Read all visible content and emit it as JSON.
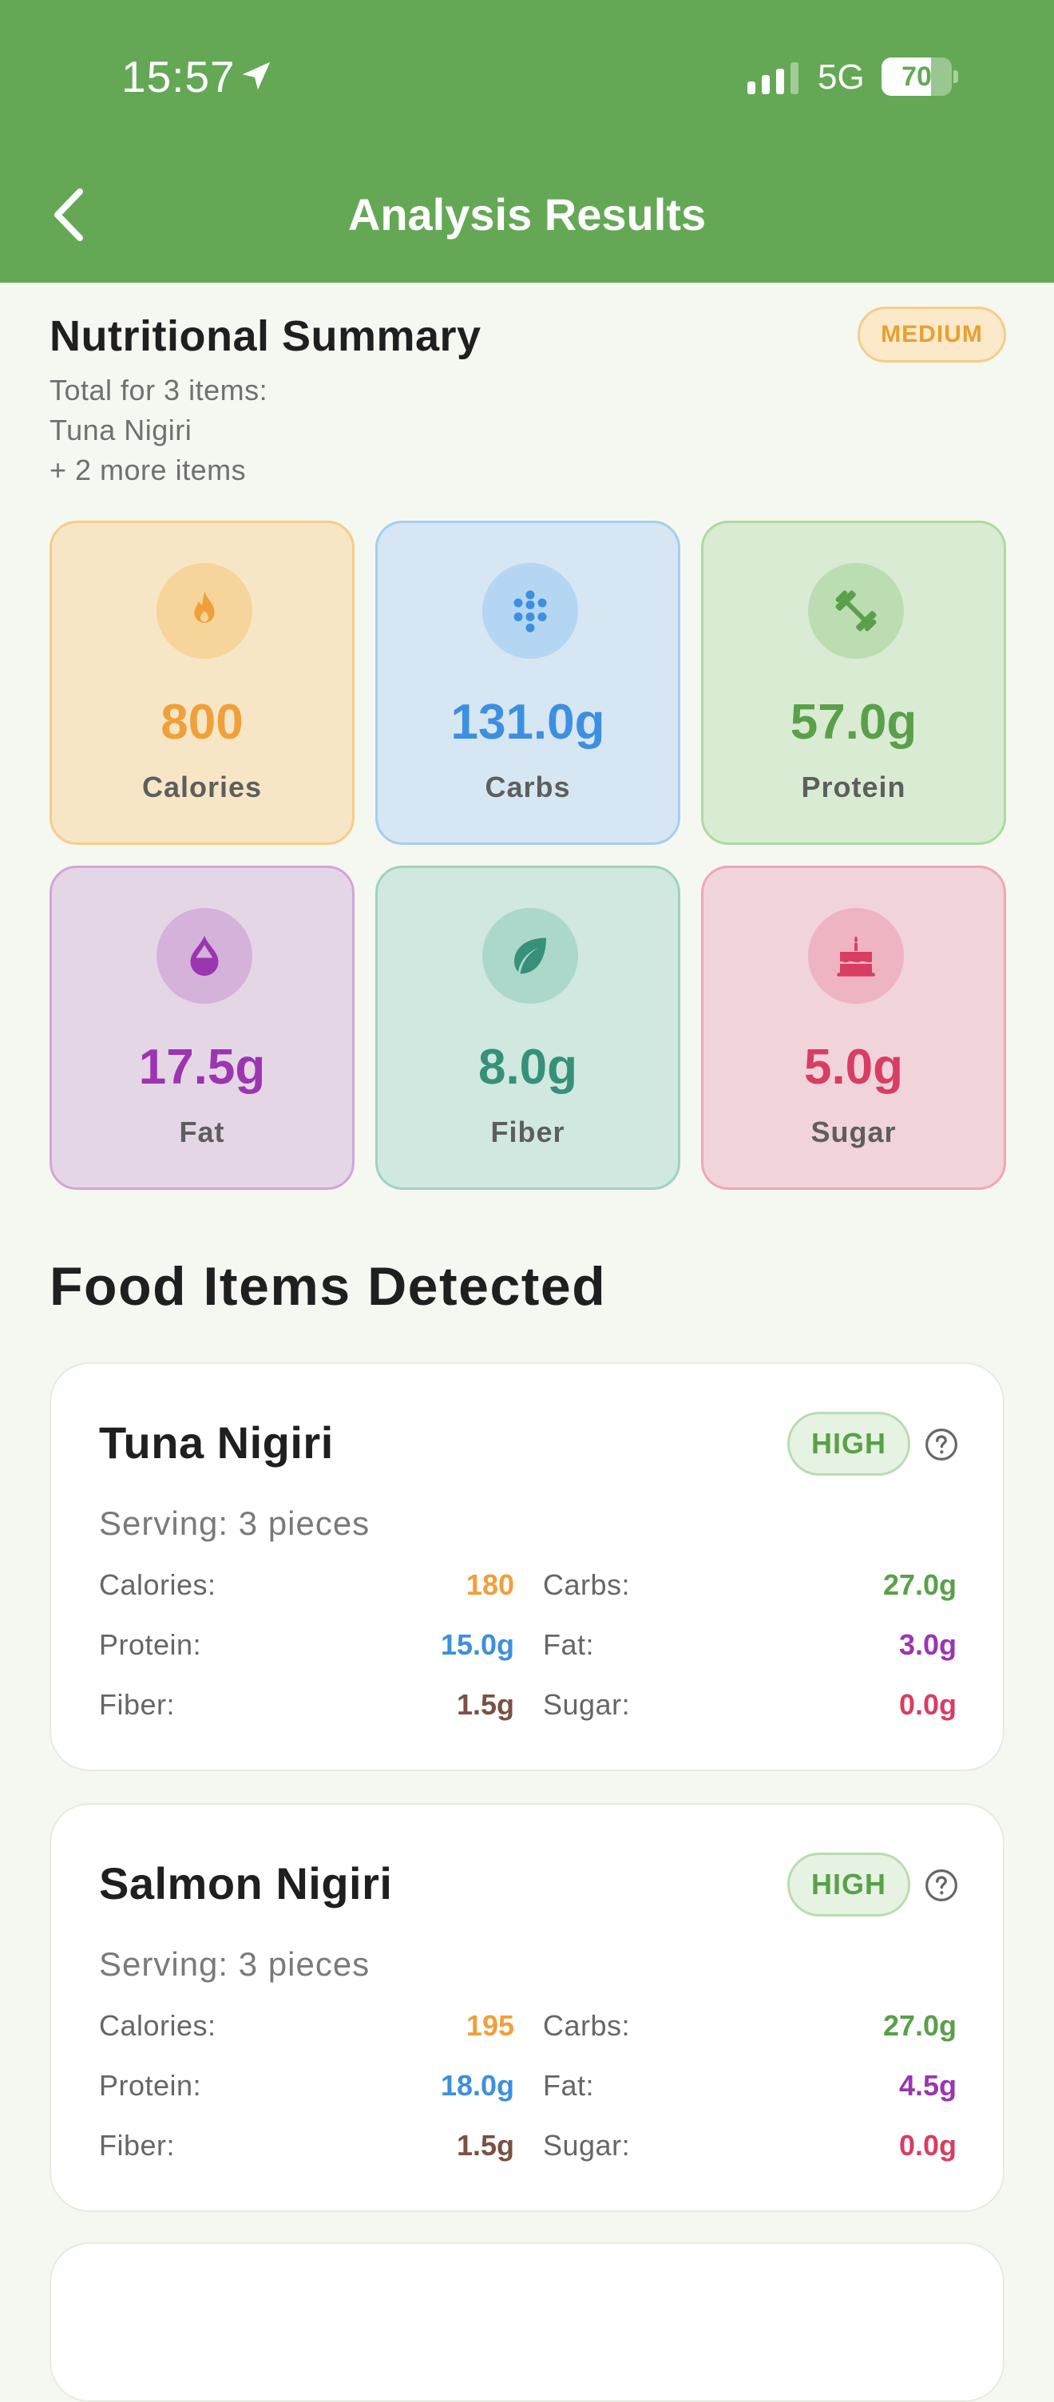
{
  "status_bar": {
    "time": "15:57",
    "network": "5G",
    "battery": "70",
    "battery_level": 0.7
  },
  "header": {
    "title": "Analysis Results"
  },
  "summary": {
    "title": "Nutritional Summary",
    "confidence": "MEDIUM",
    "subtitle_lines": [
      "Total for 3 items:",
      "Tuna Nigiri",
      "+ 2 more items"
    ],
    "tiles": [
      {
        "value": "800",
        "label": "Calories",
        "icon": "flame-icon",
        "color": "#f0a03a"
      },
      {
        "value": "131.0g",
        "label": "Carbs",
        "icon": "grain-icon",
        "color": "#3d8fe0"
      },
      {
        "value": "57.0g",
        "label": "Protein",
        "icon": "dumbbell-icon",
        "color": "#5aa04a"
      },
      {
        "value": "17.5g",
        "label": "Fat",
        "icon": "droplet-icon",
        "color": "#9b35b0"
      },
      {
        "value": "8.0g",
        "label": "Fiber",
        "icon": "leaf-icon",
        "color": "#36907a"
      },
      {
        "value": "5.0g",
        "label": "Sugar",
        "icon": "cake-icon",
        "color": "#d83d63"
      }
    ]
  },
  "food_section": {
    "title": "Food Items Detected",
    "items": [
      {
        "name": "Tuna Nigiri",
        "confidence": "HIGH",
        "serving": "Serving: 3 pieces",
        "labels": {
          "calories": "Calories:",
          "carbs": "Carbs:",
          "protein": "Protein:",
          "fat": "Fat:",
          "fiber": "Fiber:",
          "sugar": "Sugar:"
        },
        "calories": "180",
        "carbs": "27.0g",
        "protein": "15.0g",
        "fat": "3.0g",
        "fiber": "1.5g",
        "sugar": "0.0g"
      },
      {
        "name": "Salmon Nigiri",
        "confidence": "HIGH",
        "serving": "Serving: 3 pieces",
        "labels": {
          "calories": "Calories:",
          "carbs": "Carbs:",
          "protein": "Protein:",
          "fat": "Fat:",
          "fiber": "Fiber:",
          "sugar": "Sugar:"
        },
        "calories": "195",
        "carbs": "27.0g",
        "protein": "18.0g",
        "fat": "4.5g",
        "fiber": "1.5g",
        "sugar": "0.0g"
      }
    ]
  }
}
